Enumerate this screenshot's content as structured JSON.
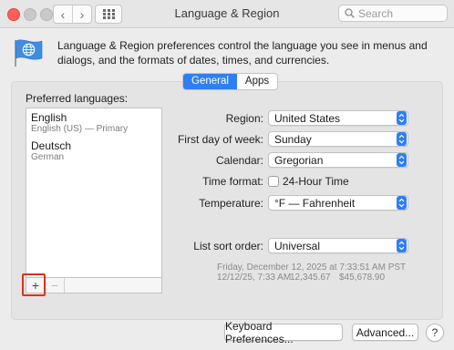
{
  "window": {
    "title": "Language & Region"
  },
  "toolbar": {
    "back_glyph": "‹",
    "forward_glyph": "›",
    "search_placeholder": "Search"
  },
  "header": {
    "description": "Language & Region preferences control the language you see in menus and dialogs, and the formats of dates, times, and currencies.",
    "icon": "globe-flag-icon"
  },
  "tabs": [
    {
      "label": "General",
      "active": true
    },
    {
      "label": "Apps",
      "active": false
    }
  ],
  "preferred_languages": {
    "label": "Preferred languages:",
    "items": [
      {
        "name": "English",
        "detail": "English (US) — Primary"
      },
      {
        "name": "Deutsch",
        "detail": "German"
      }
    ],
    "add_glyph": "+",
    "remove_glyph": "−"
  },
  "settings": {
    "region": {
      "label": "Region:",
      "value": "United States"
    },
    "first_day": {
      "label": "First day of week:",
      "value": "Sunday"
    },
    "calendar": {
      "label": "Calendar:",
      "value": "Gregorian"
    },
    "time_format": {
      "label": "Time format:",
      "checkbox_label": "24-Hour Time",
      "checked": false
    },
    "temperature": {
      "label": "Temperature:",
      "value": "°F — Fahrenheit"
    },
    "sort_order": {
      "label": "List sort order:",
      "value": "Universal"
    }
  },
  "sample": {
    "line1": "Friday, December 12, 2025 at 7:33:51 AM PST",
    "date_short": "12/12/25, 7:33 AM",
    "number": "12,345.67",
    "currency": "$45,678.90"
  },
  "buttons": {
    "keyboard": "Keyboard Preferences...",
    "advanced": "Advanced...",
    "help": "?"
  },
  "colors": {
    "accent": "#2f7ff3",
    "highlight": "#e0301e"
  }
}
